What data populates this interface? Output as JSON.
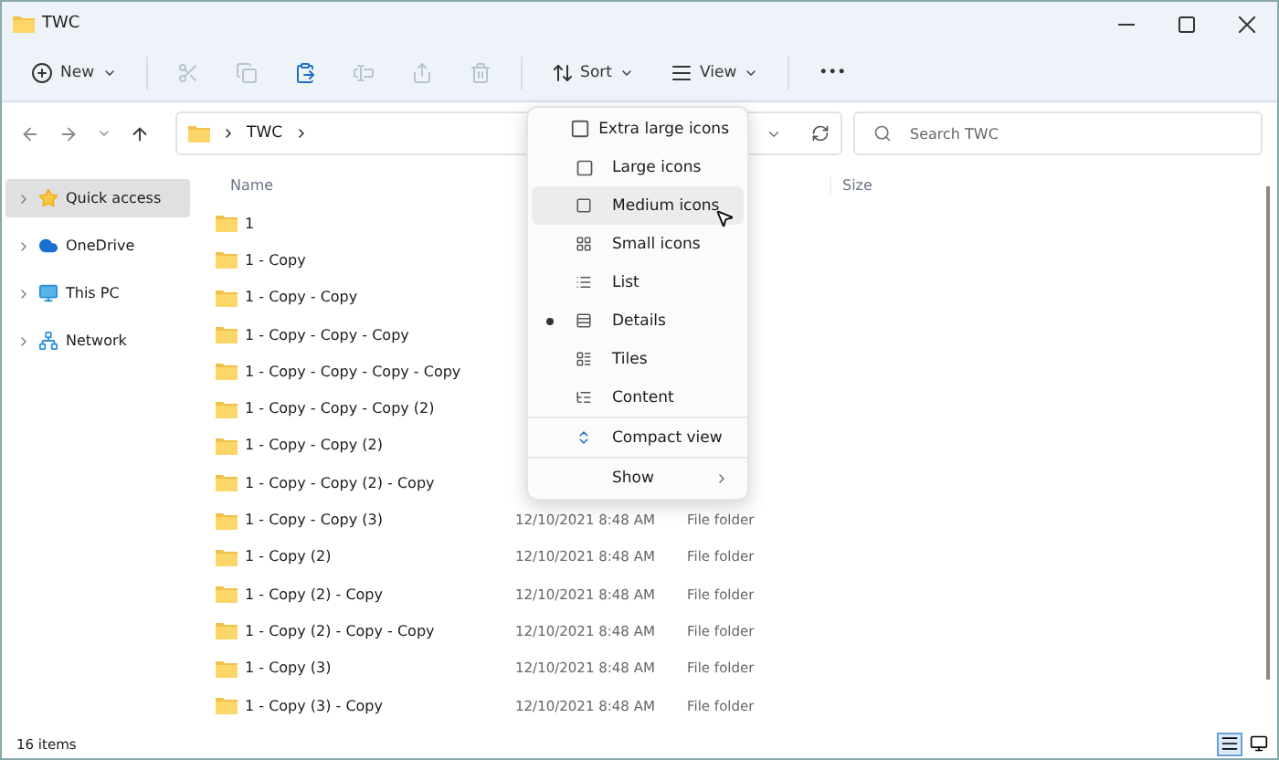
{
  "window": {
    "title": "TWC"
  },
  "toolbar": {
    "new_label": "New",
    "buttons": [
      {
        "disabled": true
      },
      {
        "disabled": true
      },
      {
        "disabled": false
      },
      {
        "disabled": true
      },
      {
        "disabled": true
      },
      {
        "disabled": true
      }
    ],
    "sort_label": "Sort",
    "view_label": "View",
    "more_label": "•••"
  },
  "address": {
    "crumbs": [
      "TWC"
    ]
  },
  "search": {
    "placeholder": "Search TWC"
  },
  "sidebar": {
    "items": [
      {
        "label": "Quick access",
        "selected": true
      },
      {
        "label": "OneDrive",
        "selected": false
      },
      {
        "label": "This PC",
        "selected": false
      },
      {
        "label": "Network",
        "selected": false
      }
    ]
  },
  "table": {
    "columns": [
      "Name",
      "Size"
    ],
    "rows": [
      {
        "name": "1"
      },
      {
        "name": "1 - Copy"
      },
      {
        "name": "1 - Copy - Copy"
      },
      {
        "name": "1 - Copy - Copy - Copy"
      },
      {
        "name": "1 - Copy - Copy - Copy - Copy"
      },
      {
        "name": "1 - Copy - Copy - Copy (2)"
      },
      {
        "name": "1 - Copy - Copy (2)"
      },
      {
        "name": "1 - Copy - Copy (2) - Copy"
      },
      {
        "name": "1 - Copy - Copy (3)",
        "date": "12/10/2021 8:48 AM",
        "type": "File folder"
      },
      {
        "name": "1 - Copy (2)",
        "date": "12/10/2021 8:48 AM",
        "type": "File folder"
      },
      {
        "name": "1 - Copy (2) - Copy",
        "date": "12/10/2021 8:48 AM",
        "type": "File folder"
      },
      {
        "name": "1 - Copy (2) - Copy - Copy",
        "date": "12/10/2021 8:48 AM",
        "type": "File folder"
      },
      {
        "name": "1 - Copy (3)",
        "date": "12/10/2021 8:48 AM",
        "type": "File folder"
      },
      {
        "name": "1 - Copy (3) - Copy",
        "date": "12/10/2021 8:48 AM",
        "type": "File folder"
      }
    ]
  },
  "view_menu": {
    "items": [
      {
        "label": "Extra large icons",
        "kind": "option",
        "selected": false,
        "hovered": false
      },
      {
        "label": "Large icons",
        "kind": "option",
        "selected": false,
        "hovered": false
      },
      {
        "label": "Medium icons",
        "kind": "option",
        "selected": false,
        "hovered": true
      },
      {
        "label": "Small icons",
        "kind": "option",
        "selected": false,
        "hovered": false
      },
      {
        "label": "List",
        "kind": "option",
        "selected": false,
        "hovered": false
      },
      {
        "label": "Details",
        "kind": "option",
        "selected": true,
        "hovered": false
      },
      {
        "label": "Tiles",
        "kind": "option",
        "selected": false,
        "hovered": false
      },
      {
        "label": "Content",
        "kind": "option",
        "selected": false,
        "hovered": false
      },
      {
        "label": "Compact view",
        "kind": "toggle",
        "selected": false,
        "hovered": false
      },
      {
        "label": "Show",
        "kind": "submenu",
        "selected": false,
        "hovered": false
      }
    ]
  },
  "status_bar": {
    "text": "16 items"
  }
}
